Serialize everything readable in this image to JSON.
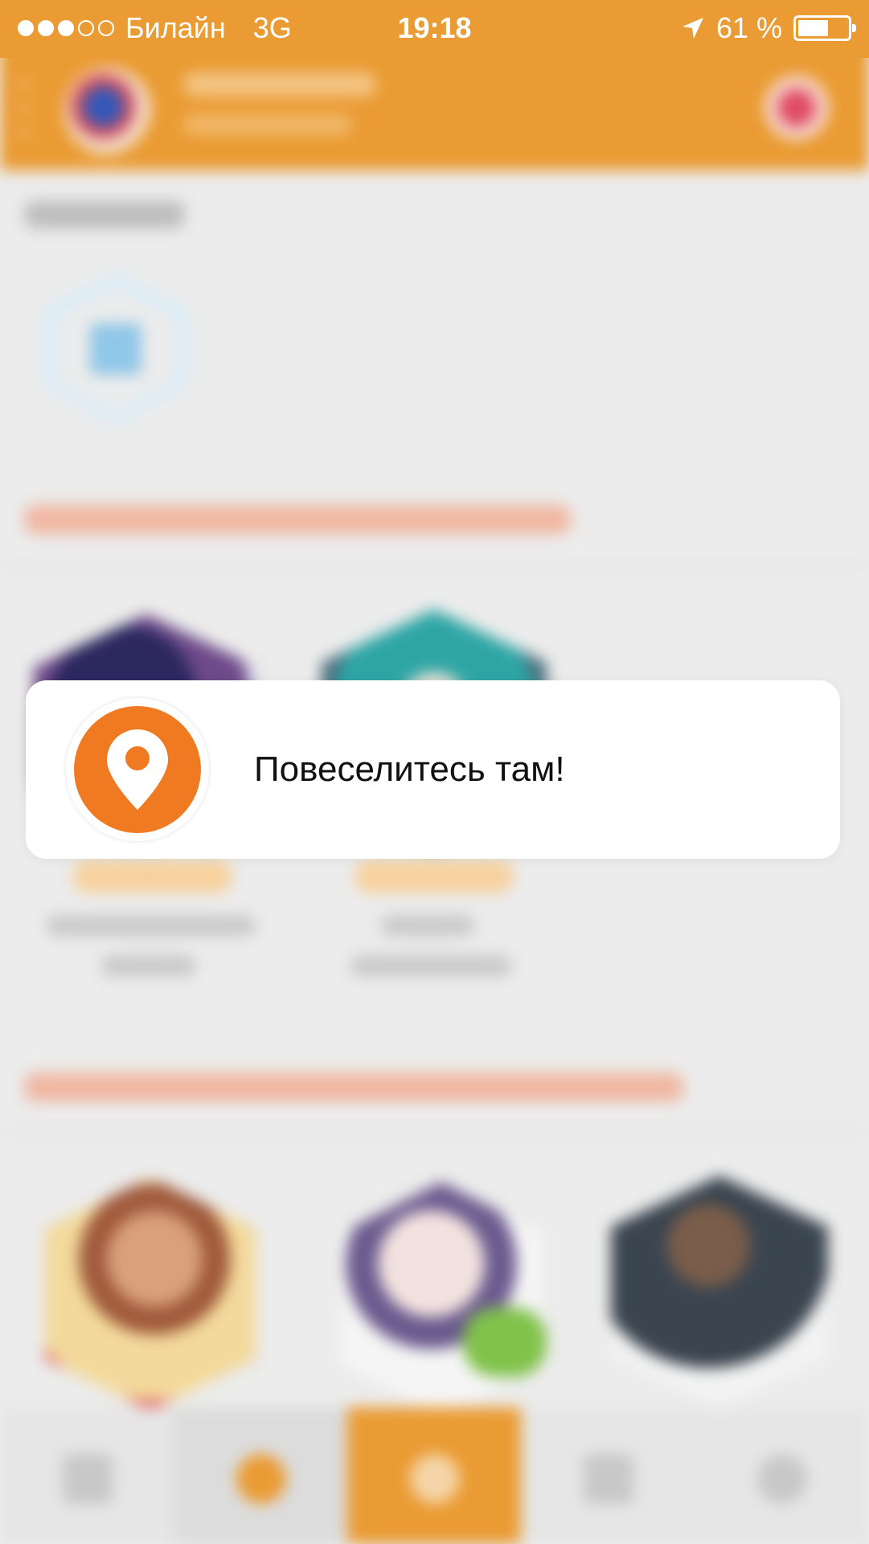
{
  "status_bar": {
    "signal_dots_filled": 3,
    "signal_dots_total": 5,
    "carrier": "Билайн",
    "network": "3G",
    "time": "19:18",
    "battery_percent": "61 %",
    "battery_level": 0.61,
    "location_icon": "location-arrow-icon"
  },
  "toast": {
    "message": "Повеселитесь там!",
    "icon": "map-pin-icon"
  },
  "tabs": [
    {
      "icon": "grid-icon"
    },
    {
      "icon": "circle-icon"
    },
    {
      "icon": "radar-icon",
      "active": true
    },
    {
      "icon": "people-icon"
    },
    {
      "icon": "profile-icon"
    }
  ],
  "colors": {
    "accent": "#ea9b33",
    "toast_icon": "#f07a22",
    "background": "#ececec"
  }
}
